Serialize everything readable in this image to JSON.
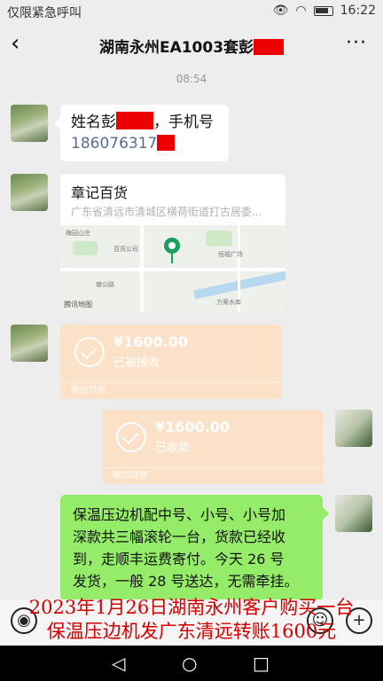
{
  "status": {
    "carrier": "仅限紧急呼叫",
    "time": "16:22"
  },
  "chat": {
    "title": "湖南永州EA1003套彭",
    "back_icon": "chevron-left-icon",
    "more_icon": "more-dots-icon"
  },
  "time_label": "08:54",
  "msg1": {
    "line1": "姓名彭",
    "line1_suffix": "，手机号",
    "phone": "186076317"
  },
  "location": {
    "name": "章记百货",
    "address": "广东省清远市清城区横荷街道打古居委...",
    "map_provider": "腾讯地图"
  },
  "transfer_received": {
    "amount": "¥1600.00",
    "status": "已被接收",
    "kind": "微信转账"
  },
  "transfer_sent": {
    "amount": "¥1600.00",
    "status": "已收款",
    "kind": "微信转账"
  },
  "reply": {
    "lines": [
      "保温压边机配中号、小号、小号加",
      "深款共三幅滚轮一台，货款已经收",
      "到，走顺丰运费寄付。今天 26 号",
      "发货，一般 28 号送达，无需牵挂。"
    ]
  },
  "caption": {
    "line1": "2023年1月26日湖南永州客户购买一台",
    "line2": "保温压边机发广东清远转账1600元"
  },
  "colors": {
    "redact": "#e00000",
    "accent_green": "#95ec69",
    "transfer": "#fbe1c7",
    "caption": "#d40000"
  }
}
